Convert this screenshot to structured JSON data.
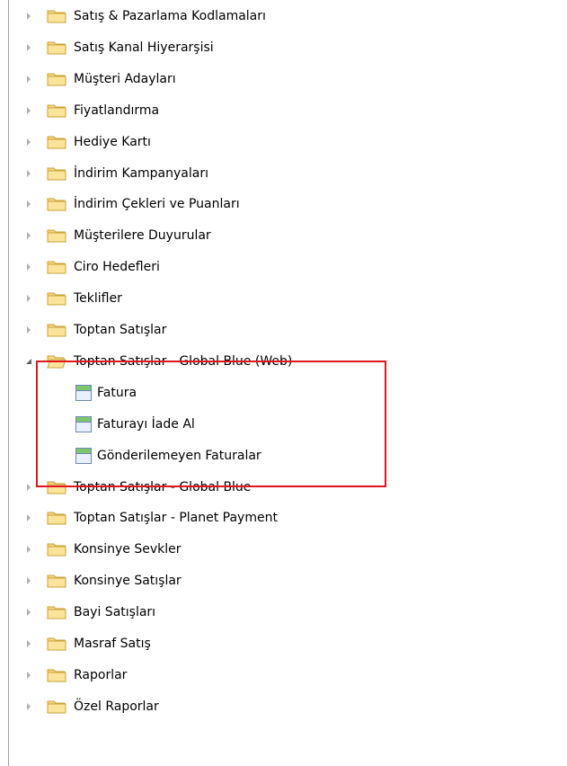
{
  "tree": {
    "items": [
      {
        "label": "Satış & Pazarlama Kodlamaları",
        "type": "folder",
        "expanded": false
      },
      {
        "label": "Satış Kanal Hiyerarşisi",
        "type": "folder",
        "expanded": false
      },
      {
        "label": "Müşteri Adayları",
        "type": "folder",
        "expanded": false
      },
      {
        "label": "Fiyatlandırma",
        "type": "folder",
        "expanded": false
      },
      {
        "label": "Hediye Kartı",
        "type": "folder",
        "expanded": false
      },
      {
        "label": "İndirim Kampanyaları",
        "type": "folder",
        "expanded": false
      },
      {
        "label": "İndirim Çekleri ve Puanları",
        "type": "folder",
        "expanded": false
      },
      {
        "label": "Müşterilere Duyurular",
        "type": "folder",
        "expanded": false
      },
      {
        "label": "Ciro Hedefleri",
        "type": "folder",
        "expanded": false
      },
      {
        "label": "Teklifler",
        "type": "folder",
        "expanded": false
      },
      {
        "label": "Toptan Satışlar",
        "type": "folder",
        "expanded": false
      },
      {
        "label": "Toptan Satışlar - Global Blue (Web)",
        "type": "folder",
        "expanded": true
      },
      {
        "label": "Fatura",
        "type": "form"
      },
      {
        "label": "Faturayı İade Al",
        "type": "form"
      },
      {
        "label": "Gönderilemeyen Faturalar",
        "type": "form"
      },
      {
        "label": "Toptan Satışlar - Global Blue",
        "type": "folder",
        "expanded": false
      },
      {
        "label": "Toptan Satışlar - Planet Payment",
        "type": "folder",
        "expanded": false
      },
      {
        "label": "Konsinye Sevkler",
        "type": "folder",
        "expanded": false
      },
      {
        "label": "Konsinye Satışlar",
        "type": "folder",
        "expanded": false
      },
      {
        "label": "Bayi Satışları",
        "type": "folder",
        "expanded": false
      },
      {
        "label": "Masraf Satış",
        "type": "folder",
        "expanded": false
      },
      {
        "label": "Raporlar",
        "type": "folder",
        "expanded": false
      },
      {
        "label": "Özel Raporlar",
        "type": "folder",
        "expanded": false
      }
    ]
  },
  "colors": {
    "highlight_border": "#e0161e",
    "folder_fill": "#f7d77a",
    "form_header": "#7fc66a"
  }
}
